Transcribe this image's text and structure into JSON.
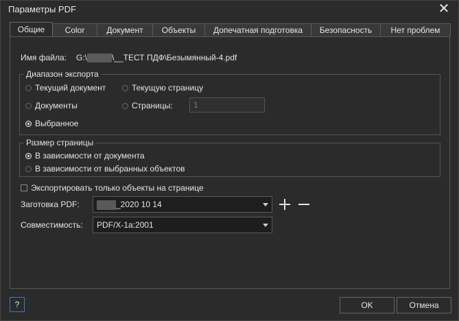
{
  "window": {
    "title": "Параметры PDF"
  },
  "tabs": [
    {
      "label": "Общие",
      "active": true
    },
    {
      "label": "Color"
    },
    {
      "label": "Документ"
    },
    {
      "label": "Объекты"
    },
    {
      "label": "Допечатная подготовка"
    },
    {
      "label": "Безопасность"
    },
    {
      "label": "Нет проблем"
    }
  ],
  "file": {
    "label": "Имя файла:",
    "path_prefix": "G:\\",
    "path_suffix": "\\__ТЕСТ ПДФ\\Безымянный-4.pdf"
  },
  "export_range": {
    "title": "Диапазон экспорта",
    "current_document": "Текущий документ",
    "documents": "Документы",
    "selection": "Выбранное",
    "current_page": "Текущую страницу",
    "pages_label": "Страницы:",
    "pages_value": "1",
    "selected": "selection"
  },
  "page_size": {
    "title": "Размер страницы",
    "from_document": "В зависимости от документа",
    "from_objects": "В зависимости от выбранных объектов",
    "selected": "from_document"
  },
  "export_only_on_page": {
    "label": "Экспортировать только объекты на странице",
    "checked": false
  },
  "preset": {
    "label": "Заготовка PDF:",
    "value_suffix": "_2020 10 14"
  },
  "compat": {
    "label": "Совместимость:",
    "value": "PDF/X-1a:2001"
  },
  "buttons": {
    "help": "?",
    "ok": "OK",
    "cancel": "Отмена"
  },
  "colors": {
    "background": "#2b2b2b",
    "focus_border": "#3d7ac4",
    "redaction": "#5a5a5a"
  }
}
